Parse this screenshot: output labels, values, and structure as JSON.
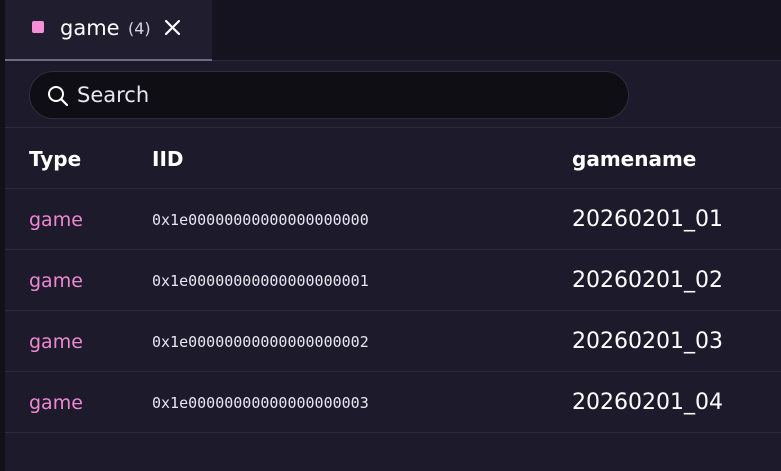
{
  "tab": {
    "label": "game",
    "count": "(4)",
    "swatch_color": "#f48fd8",
    "close_icon": "close-icon"
  },
  "search": {
    "placeholder": "Search",
    "value": "",
    "icon": "search-icon"
  },
  "table": {
    "headers": {
      "type": "Type",
      "iid": "IID",
      "gamename": "gamename"
    },
    "rows": [
      {
        "type": "game",
        "iid": "0x1e00000000000000000000",
        "gamename": "20260201_01"
      },
      {
        "type": "game",
        "iid": "0x1e00000000000000000001",
        "gamename": "20260201_02"
      },
      {
        "type": "game",
        "iid": "0x1e00000000000000000002",
        "gamename": "20260201_03"
      },
      {
        "type": "game",
        "iid": "0x1e00000000000000000003",
        "gamename": "20260201_04"
      }
    ]
  },
  "colors": {
    "accent": "#f48fd8",
    "type_text": "#ee88d2",
    "background": "#1d1b2b"
  }
}
